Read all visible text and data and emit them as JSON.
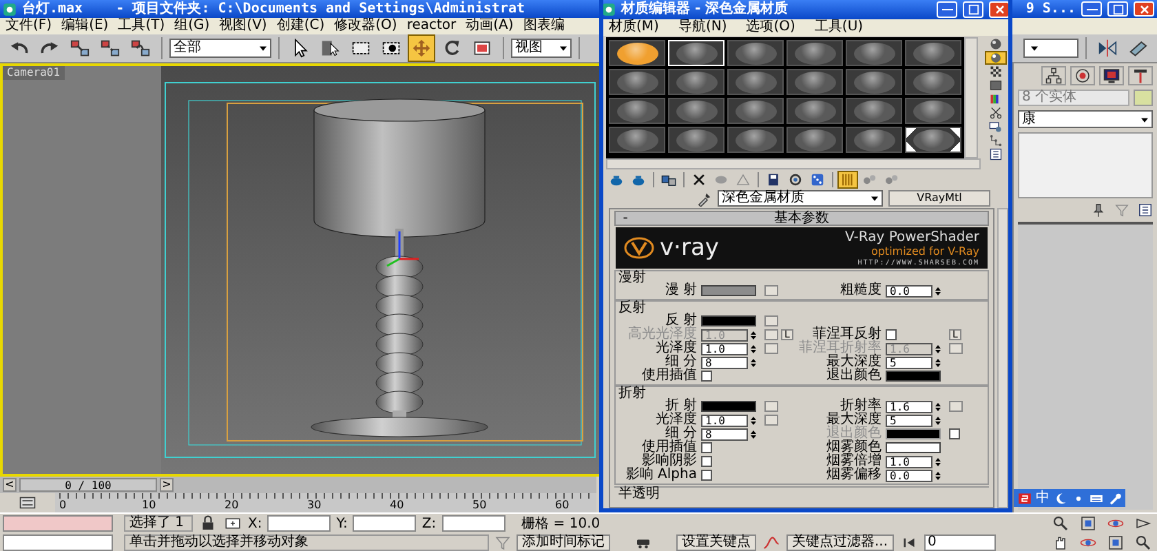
{
  "main_window": {
    "title": "台灯.max    - 项目文件夹: C:\\Documents and Settings\\Administrat",
    "title_end": "9 S..."
  },
  "menu": [
    "文件(F)",
    "编辑(E)",
    "工具(T)",
    "组(G)",
    "视图(V)",
    "创建(C)",
    "修改器(O)",
    "reactor",
    "动画(A)",
    "图表编"
  ],
  "toolbar": {
    "items": [
      {
        "kind": "curved-arrow-left",
        "selected": false
      },
      {
        "kind": "curved-arrow-right",
        "selected": false
      },
      {
        "kind": "linked-squares",
        "selected": false
      },
      {
        "kind": "unlinked-squares",
        "selected": false
      },
      {
        "kind": "tangled-squares",
        "selected": false
      },
      {
        "kind": "dropdown",
        "value": "全部"
      },
      {
        "kind": "cursor-arrow",
        "selected": false
      },
      {
        "kind": "list-cursor",
        "selected": false
      },
      {
        "kind": "dashed-rectangle",
        "selected": false
      },
      {
        "kind": "dashed-rectangle-dot",
        "selected": false
      },
      {
        "kind": "four-arrows",
        "selected": true
      },
      {
        "kind": "circular-arrow",
        "selected": false
      },
      {
        "kind": "framed-square",
        "selected": false
      },
      {
        "kind": "dropdown",
        "value": "视图"
      }
    ]
  },
  "viewport": {
    "label": "Camera01"
  },
  "time_slider": {
    "prev": "<",
    "position": "0 / 100",
    "next": ">"
  },
  "ruler": {
    "labels": [
      "0",
      "10",
      "20",
      "30",
      "40",
      "50",
      "60"
    ]
  },
  "command_panel": {
    "object_count": "8 个实体",
    "modifier_list": "康"
  },
  "ime_bar": {
    "label": "中"
  },
  "status": {
    "selected_count": "选择了 1",
    "x_label": "X:",
    "y_label": "Y:",
    "z_label": "Z:",
    "grid": "栅格 = 10.0",
    "prompt": "单击并拖动以选择并移动对象",
    "add_time_tag": "添加时间标记",
    "set_key": "设置关键点",
    "key_filters": "关键点过滤器...",
    "frame": "0"
  },
  "material_editor": {
    "title": "材质编辑器 - 深色金属材质",
    "menu": [
      "材质(M)",
      "导航(N)",
      "选项(O)",
      "工具(U)"
    ],
    "slots": [
      {
        "color": "#f0a030",
        "selected": false,
        "hot": false
      },
      {
        "color": "#5a5a5a",
        "selected": true,
        "hot": false
      },
      {
        "color": "#5a5a5a",
        "selected": false,
        "hot": false
      },
      {
        "color": "#5a5a5a",
        "selected": false,
        "hot": false
      },
      {
        "color": "#5a5a5a",
        "selected": false,
        "hot": false
      },
      {
        "color": "#5a5a5a",
        "selected": false,
        "hot": false
      },
      {
        "color": "#5a5a5a",
        "selected": false,
        "hot": false
      },
      {
        "color": "#5a5a5a",
        "selected": false,
        "hot": false
      },
      {
        "color": "#5a5a5a",
        "selected": false,
        "hot": false
      },
      {
        "color": "#5a5a5a",
        "selected": false,
        "hot": false
      },
      {
        "color": "#5a5a5a",
        "selected": false,
        "hot": false
      },
      {
        "color": "#5a5a5a",
        "selected": false,
        "hot": false
      },
      {
        "color": "#5a5a5a",
        "selected": false,
        "hot": false
      },
      {
        "color": "#5a5a5a",
        "selected": false,
        "hot": false
      },
      {
        "color": "#5a5a5a",
        "selected": false,
        "hot": false
      },
      {
        "color": "#5a5a5a",
        "selected": false,
        "hot": false
      },
      {
        "color": "#5a5a5a",
        "selected": false,
        "hot": false
      },
      {
        "color": "#5a5a5a",
        "selected": false,
        "hot": false
      },
      {
        "color": "#5a5a5a",
        "selected": false,
        "hot": false
      },
      {
        "color": "#5a5a5a",
        "selected": false,
        "hot": false
      },
      {
        "color": "#5a5a5a",
        "selected": false,
        "hot": false
      },
      {
        "color": "#5a5a5a",
        "selected": false,
        "hot": false
      },
      {
        "color": "#5a5a5a",
        "selected": false,
        "hot": false
      },
      {
        "color": "#5a5a5a",
        "selected": false,
        "hot": true
      }
    ],
    "side_tools": [
      {
        "kind": "sphere",
        "selected": false
      },
      {
        "kind": "lit-sphere",
        "selected": true
      },
      {
        "kind": "checker",
        "selected": false
      },
      {
        "kind": "square",
        "selected": false
      },
      {
        "kind": "color-bars",
        "selected": false
      },
      {
        "kind": "scissors",
        "selected": false
      },
      {
        "kind": "display-stack",
        "selected": false
      },
      {
        "kind": "dots-tree",
        "selected": false
      },
      {
        "kind": "film-stack",
        "selected": false
      }
    ],
    "tools": [
      {
        "kind": "pot",
        "selected": false
      },
      {
        "kind": "pot",
        "selected": false
      },
      {
        "kind": "cubes",
        "selected": false
      },
      {
        "kind": "cross",
        "selected": false
      },
      {
        "kind": "blob",
        "selected": false
      },
      {
        "kind": "triangle",
        "selected": false
      },
      {
        "kind": "disk",
        "selected": false
      },
      {
        "kind": "ring",
        "selected": false
      },
      {
        "kind": "dice",
        "selected": false
      },
      {
        "kind": "bars",
        "selected": true
      },
      {
        "kind": "cogs",
        "selected": false
      },
      {
        "kind": "cogs",
        "selected": false
      }
    ],
    "material_name": "深色金属材质",
    "material_type": "VRayMtl",
    "rollout": {
      "toggle": "-",
      "title": "基本参数"
    },
    "banner": {
      "logo": "v·ray",
      "headline": "V-Ray PowerShader",
      "tagline": "optimized for V-Ray",
      "url": "HTTP://WWW.SHARSEB.COM"
    },
    "groups": [
      {
        "title": "漫射",
        "rows": [
          {
            "left": {
              "label": "漫 射",
              "kind": "swatch",
              "color": "#8c8c8c",
              "disabled": false,
              "map_button": true
            },
            "right": {
              "label": "粗糙度",
              "kind": "spinner",
              "value": "0.0",
              "disabled": false
            }
          }
        ]
      },
      {
        "title": "反射",
        "rows": [
          {
            "left": {
              "label": "反 射",
              "kind": "swatch",
              "color": "#000000",
              "disabled": false,
              "map_button": true
            }
          },
          {
            "left": {
              "label": "高光光泽度",
              "kind": "spinner",
              "value": "1.0",
              "disabled": true,
              "map_button": true,
              "lock": "L"
            },
            "right": {
              "label": "菲涅耳反射",
              "kind": "check",
              "checked": false,
              "disabled": false,
              "lock": "L"
            }
          },
          {
            "left": {
              "label": "光泽度",
              "kind": "spinner",
              "value": "1.0",
              "disabled": false,
              "map_button": true
            },
            "right": {
              "label": "菲涅耳折射率",
              "kind": "spinner",
              "value": "1.6",
              "disabled": true,
              "map_button": true
            }
          },
          {
            "left": {
              "label": "细 分",
              "kind": "spinner",
              "value": "8",
              "disabled": false
            },
            "right": {
              "label": "最大深度",
              "kind": "spinner",
              "value": "5",
              "disabled": false
            }
          },
          {
            "left": {
              "label": "使用插值",
              "kind": "check",
              "checked": false,
              "disabled": false
            },
            "right": {
              "label": "退出颜色",
              "kind": "swatch",
              "color": "#000000",
              "disabled": false
            }
          }
        ]
      },
      {
        "title": "折射",
        "rows": [
          {
            "left": {
              "label": "折 射",
              "kind": "swatch",
              "color": "#000000",
              "disabled": false,
              "map_button": true
            },
            "right": {
              "label": "折射率",
              "kind": "spinner",
              "value": "1.6",
              "disabled": false,
              "map_button": true
            }
          },
          {
            "left": {
              "label": "光泽度",
              "kind": "spinner",
              "value": "1.0",
              "disabled": false,
              "map_button": true
            },
            "right": {
              "label": "最大深度",
              "kind": "spinner",
              "value": "5",
              "disabled": false
            }
          },
          {
            "left": {
              "label": "细 分",
              "kind": "spinner",
              "value": "8",
              "disabled": false
            },
            "right": {
              "label": "退出颜色",
              "kind": "swatch",
              "color": "#000000",
              "disabled": true,
              "extra_checked": false
            }
          },
          {
            "left": {
              "label": "使用插值",
              "kind": "check",
              "checked": false,
              "disabled": false
            },
            "right": {
              "label": "烟雾颜色",
              "kind": "swatch",
              "color": "#ffffff",
              "disabled": false
            }
          },
          {
            "left": {
              "label": "影响阴影",
              "kind": "check",
              "checked": false,
              "disabled": false
            },
            "right": {
              "label": "烟雾倍增",
              "kind": "spinner",
              "value": "1.0",
              "disabled": false
            }
          },
          {
            "left": {
              "label": "影响 Alpha",
              "kind": "check",
              "checked": false,
              "disabled": false
            },
            "right": {
              "label": "烟雾偏移",
              "kind": "spinner",
              "value": "0.0",
              "disabled": false
            }
          }
        ]
      }
    ],
    "next_group": "半透明"
  }
}
